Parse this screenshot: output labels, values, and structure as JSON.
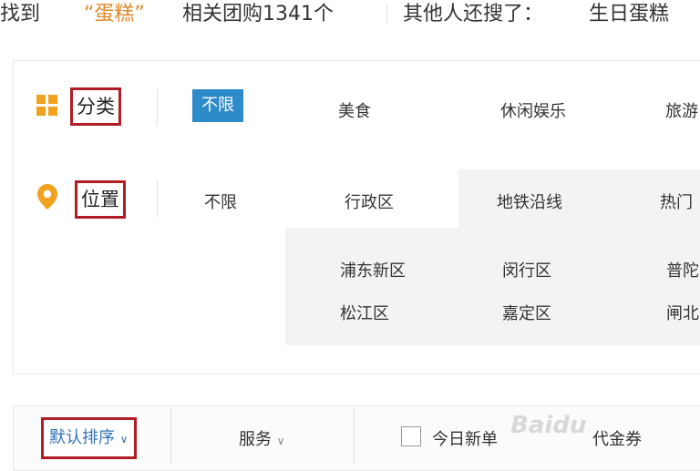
{
  "header": {
    "found_prefix": "找到",
    "keyword": "“蛋糕”",
    "result_count_text": "相关团购1341个",
    "others_searched_label": "其他人还搜了：",
    "suggestion": "生日蛋糕"
  },
  "category": {
    "label": "分类",
    "options": [
      "不限",
      "美食",
      "休闲娱乐",
      "旅游"
    ]
  },
  "location": {
    "label": "位置",
    "unlimited": "不限",
    "tabs": [
      "行政区",
      "地铁沿线",
      "热门"
    ],
    "districts": [
      "浦东新区",
      "闵行区",
      "普陀",
      "松江区",
      "嘉定区",
      "闸北"
    ]
  },
  "sortbar": {
    "default_sort": "默认排序",
    "service": "服务",
    "today_new": "今日新单",
    "extra": "代金券",
    "watermark": "Baidu"
  },
  "colors": {
    "accent_blue": "#2e8bc9",
    "highlight_red": "#b01d25",
    "keyword_orange": "#e08a2b",
    "icon_orange": "#f0a21e"
  }
}
